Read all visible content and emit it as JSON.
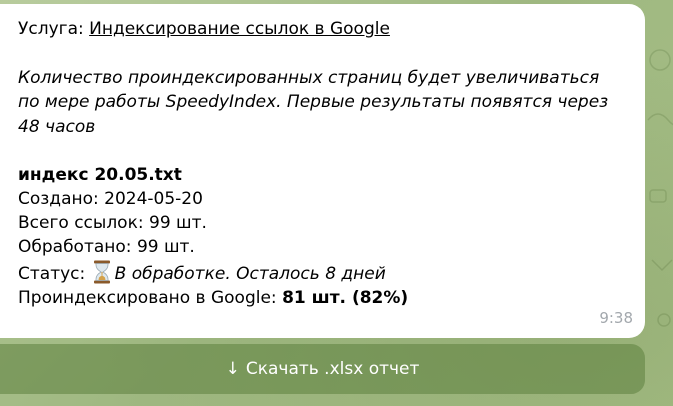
{
  "message": {
    "service_label": "Услуга: ",
    "service_link": "Индексирование ссылок в Google",
    "note_lines": [
      "Количество проиндексированных страниц будет увеличиваться",
      "по мере работы SpeedyIndex. Первые результаты появятся через",
      "48 часов"
    ],
    "filename": "индекс 20.05.txt",
    "created_label": "Создано: ",
    "created_value": "2024-05-20",
    "total_label": "Всего ссылок: ",
    "total_value": "99 шт.",
    "processed_label": "Обработано: ",
    "processed_value": "99 шт.",
    "status_label": "Статус: ",
    "status_icon": "hourglass-icon",
    "status_value": "В обработке. Осталось 8 дней",
    "indexed_label": "Проиндексировано в Google: ",
    "indexed_value": "81 шт. (82%)",
    "time": "9:38"
  },
  "download_button": {
    "arrow": "↓",
    "label": "Скачать .xlsx отчет"
  },
  "colors": {
    "bubble": "#ffffff",
    "chat_background": "#a9c08a",
    "button": "#6d8f4e",
    "time": "#a3a8ad"
  }
}
